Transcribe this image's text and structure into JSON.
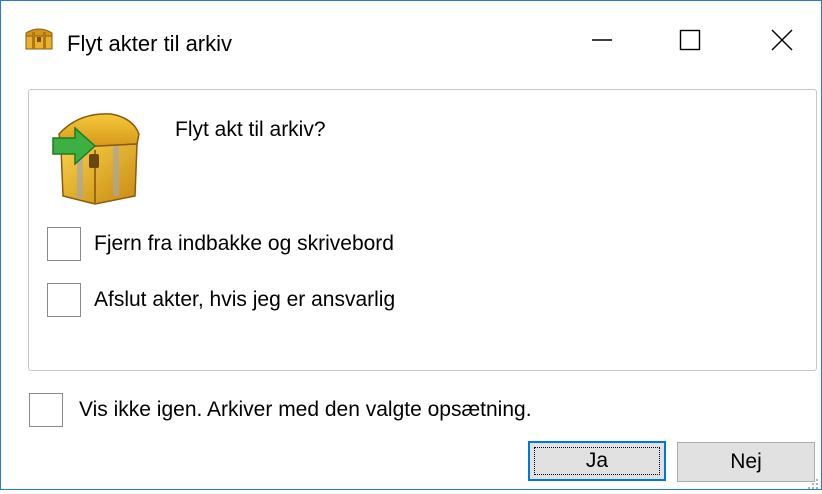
{
  "window": {
    "title": "Flyt akter til arkiv",
    "title_icon": "archive-chest-icon",
    "controls": {
      "minimize_icon": "minimize-icon",
      "maximize_icon": "maximize-icon",
      "close_icon": "close-icon"
    }
  },
  "dialog": {
    "icon": "archive-chest-arrow-icon",
    "prompt": "Flyt akt til arkiv?",
    "options": [
      {
        "label": "Fjern fra indbakke og skrivebord",
        "checked": false
      },
      {
        "label": "Afslut akter, hvis jeg er ansvarlig",
        "checked": false
      }
    ],
    "dont_show_again": {
      "label": "Vis ikke igen. Arkiver med den valgte opsætning.",
      "checked": false
    }
  },
  "buttons": {
    "yes_label": "Ja",
    "no_label": "Nej"
  },
  "colors": {
    "window_border": "#2b79c9",
    "focus_border": "#0078d7",
    "button_face": "#e1e1e1",
    "chest_gold": "#e3a21a",
    "arrow_green": "#3cb043"
  }
}
